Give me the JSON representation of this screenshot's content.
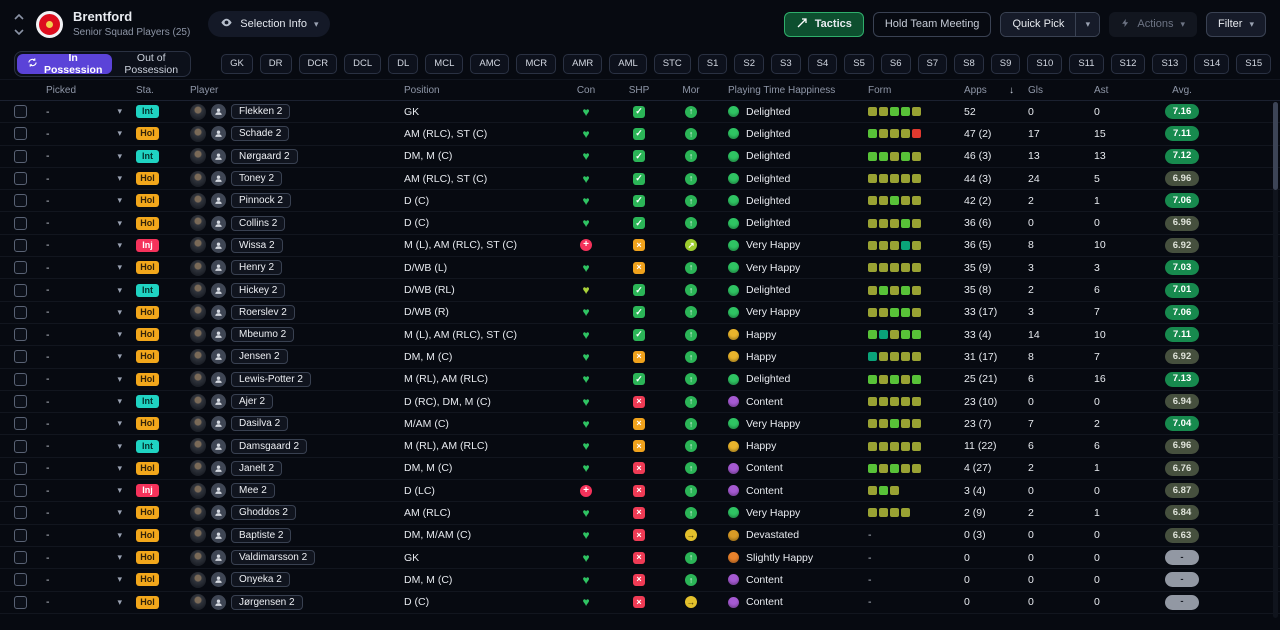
{
  "topbar": {
    "club_name": "Brentford",
    "subtitle": "Senior Squad Players (25)",
    "selection_info_label": "Selection Info",
    "tactics_label": "Tactics",
    "hold_team_meeting_label": "Hold Team Meeting",
    "quick_pick_label": "Quick Pick",
    "actions_label": "Actions",
    "filter_label": "Filter"
  },
  "tabs": {
    "in_possession": "In Possession",
    "out_of_possession": "Out of Possession"
  },
  "position_filters": [
    "GK",
    "DR",
    "DCR",
    "DCL",
    "DL",
    "MCL",
    "AMC",
    "MCR",
    "AMR",
    "AML",
    "STC",
    "S1",
    "S2",
    "S3",
    "S4",
    "S5",
    "S6",
    "S7",
    "S8",
    "S9",
    "S10",
    "S11",
    "S12",
    "S13",
    "S14",
    "S15"
  ],
  "icons": {
    "chevron_down": "▾",
    "sort_desc": "↓",
    "check": "✓",
    "cross": "×",
    "plus": "+",
    "heart": "♥",
    "arrow_up": "↑",
    "arrow_up_right": "↗",
    "arrow_right": "→"
  },
  "colors": {
    "accent_purple": "#5b43d8",
    "tactics_green": "#0d4f2f",
    "status_int": "#1fd3c2",
    "status_hol": "#f2a71b",
    "status_inj": "#f5325b"
  },
  "table": {
    "columns": {
      "picked": "Picked",
      "sta": "Sta.",
      "player": "Player",
      "position": "Position",
      "con": "Con",
      "shp": "SHP",
      "mor": "Mor",
      "happiness": "Playing Time Happiness",
      "form": "Form",
      "apps": "Apps",
      "gls": "Gls",
      "ast": "Ast",
      "avg": "Avg."
    },
    "rows": [
      {
        "picked": "-",
        "status": "Int",
        "status_type": "int",
        "name": "Flekken 2",
        "position": "GK",
        "con": "fit",
        "shp": "check",
        "mor": "up",
        "happiness": "Delighted",
        "happiness_type": "delighted",
        "form": [
          "olive",
          "olive",
          "green",
          "green",
          "olive"
        ],
        "apps": "52",
        "gls": "0",
        "ast": "0",
        "avg": "7.16",
        "avg_type": "good"
      },
      {
        "picked": "-",
        "status": "Hol",
        "status_type": "hol",
        "name": "Schade 2",
        "position": "AM (RLC), ST (C)",
        "con": "fit",
        "shp": "check",
        "mor": "up",
        "happiness": "Delighted",
        "happiness_type": "delighted",
        "form": [
          "green",
          "olive",
          "olive",
          "olive",
          "red"
        ],
        "apps": "47 (2)",
        "gls": "17",
        "ast": "15",
        "avg": "7.11",
        "avg_type": "good"
      },
      {
        "picked": "-",
        "status": "Int",
        "status_type": "int",
        "name": "Nørgaard 2",
        "position": "DM, M (C)",
        "con": "fit",
        "shp": "check",
        "mor": "up",
        "happiness": "Delighted",
        "happiness_type": "delighted",
        "form": [
          "green",
          "green",
          "olive",
          "green",
          "olive"
        ],
        "apps": "46 (3)",
        "gls": "13",
        "ast": "13",
        "avg": "7.12",
        "avg_type": "good"
      },
      {
        "picked": "-",
        "status": "Hol",
        "status_type": "hol",
        "name": "Toney 2",
        "position": "AM (RLC), ST (C)",
        "con": "fit",
        "shp": "check",
        "mor": "up",
        "happiness": "Delighted",
        "happiness_type": "delighted",
        "form": [
          "olive",
          "olive",
          "olive",
          "olive",
          "olive"
        ],
        "apps": "44 (3)",
        "gls": "24",
        "ast": "5",
        "avg": "6.96",
        "avg_type": "ok"
      },
      {
        "picked": "-",
        "status": "Hol",
        "status_type": "hol",
        "name": "Pinnock 2",
        "position": "D (C)",
        "con": "fit",
        "shp": "check",
        "mor": "up",
        "happiness": "Delighted",
        "happiness_type": "delighted",
        "form": [
          "olive",
          "olive",
          "green",
          "olive",
          "olive"
        ],
        "apps": "42 (2)",
        "gls": "2",
        "ast": "1",
        "avg": "7.06",
        "avg_type": "good"
      },
      {
        "picked": "-",
        "status": "Hol",
        "status_type": "hol",
        "name": "Collins 2",
        "position": "D (C)",
        "con": "fit",
        "shp": "check",
        "mor": "up",
        "happiness": "Delighted",
        "happiness_type": "delighted",
        "form": [
          "olive",
          "olive",
          "olive",
          "green",
          "olive"
        ],
        "apps": "36 (6)",
        "gls": "0",
        "ast": "0",
        "avg": "6.96",
        "avg_type": "ok"
      },
      {
        "picked": "-",
        "status": "Inj",
        "status_type": "inj",
        "name": "Wissa 2",
        "position": "M (L), AM (RLC), ST (C)",
        "con": "injured",
        "shp": "warn",
        "mor": "upright",
        "happiness": "Very Happy",
        "happiness_type": "very-happy",
        "form": [
          "olive",
          "olive",
          "olive",
          "teal",
          "olive"
        ],
        "apps": "36 (5)",
        "gls": "8",
        "ast": "10",
        "avg": "6.92",
        "avg_type": "ok"
      },
      {
        "picked": "-",
        "status": "Hol",
        "status_type": "hol",
        "name": "Henry 2",
        "position": "D/WB (L)",
        "con": "fit",
        "shp": "warn",
        "mor": "up",
        "happiness": "Very Happy",
        "happiness_type": "very-happy",
        "form": [
          "olive",
          "olive",
          "olive",
          "olive",
          "olive"
        ],
        "apps": "35 (9)",
        "gls": "3",
        "ast": "3",
        "avg": "7.03",
        "avg_type": "good"
      },
      {
        "picked": "-",
        "status": "Int",
        "status_type": "int",
        "name": "Hickey 2",
        "position": "D/WB (RL)",
        "con": "fit-light",
        "shp": "check",
        "mor": "up",
        "happiness": "Delighted",
        "happiness_type": "delighted",
        "form": [
          "olive",
          "green",
          "olive",
          "green",
          "olive"
        ],
        "apps": "35 (8)",
        "gls": "2",
        "ast": "6",
        "avg": "7.01",
        "avg_type": "good"
      },
      {
        "picked": "-",
        "status": "Hol",
        "status_type": "hol",
        "name": "Roerslev 2",
        "position": "D/WB (R)",
        "con": "fit",
        "shp": "check",
        "mor": "up",
        "happiness": "Very Happy",
        "happiness_type": "very-happy",
        "form": [
          "olive",
          "olive",
          "green",
          "green",
          "olive"
        ],
        "apps": "33 (17)",
        "gls": "3",
        "ast": "7",
        "avg": "7.06",
        "avg_type": "good"
      },
      {
        "picked": "-",
        "status": "Hol",
        "status_type": "hol",
        "name": "Mbeumo 2",
        "position": "M (L), AM (RLC), ST (C)",
        "con": "fit",
        "shp": "check",
        "mor": "up",
        "happiness": "Happy",
        "happiness_type": "happy",
        "form": [
          "green",
          "teal",
          "olive",
          "green",
          "green"
        ],
        "apps": "33 (4)",
        "gls": "14",
        "ast": "10",
        "avg": "7.11",
        "avg_type": "good"
      },
      {
        "picked": "-",
        "status": "Hol",
        "status_type": "hol",
        "name": "Jensen 2",
        "position": "DM, M (C)",
        "con": "fit",
        "shp": "warn",
        "mor": "up",
        "happiness": "Happy",
        "happiness_type": "happy",
        "form": [
          "teal",
          "olive",
          "olive",
          "olive",
          "olive"
        ],
        "apps": "31 (17)",
        "gls": "8",
        "ast": "7",
        "avg": "6.92",
        "avg_type": "ok"
      },
      {
        "picked": "-",
        "status": "Hol",
        "status_type": "hol",
        "name": "Lewis-Potter 2",
        "position": "M (RL), AM (RLC)",
        "con": "fit",
        "shp": "check",
        "mor": "up",
        "happiness": "Delighted",
        "happiness_type": "delighted",
        "form": [
          "green",
          "olive",
          "green",
          "olive",
          "green"
        ],
        "apps": "25 (21)",
        "gls": "6",
        "ast": "16",
        "avg": "7.13",
        "avg_type": "good"
      },
      {
        "picked": "-",
        "status": "Int",
        "status_type": "int",
        "name": "Ajer 2",
        "position": "D (RC), DM, M (C)",
        "con": "fit",
        "shp": "poor",
        "mor": "up",
        "happiness": "Content",
        "happiness_type": "content",
        "form": [
          "olive",
          "olive",
          "olive",
          "olive",
          "olive"
        ],
        "apps": "23 (10)",
        "gls": "0",
        "ast": "0",
        "avg": "6.94",
        "avg_type": "ok"
      },
      {
        "picked": "-",
        "status": "Hol",
        "status_type": "hol",
        "name": "Dasilva 2",
        "position": "M/AM (C)",
        "con": "fit",
        "shp": "warn",
        "mor": "up",
        "happiness": "Very Happy",
        "happiness_type": "very-happy",
        "form": [
          "olive",
          "olive",
          "green",
          "olive",
          "olive"
        ],
        "apps": "23 (7)",
        "gls": "7",
        "ast": "2",
        "avg": "7.04",
        "avg_type": "good"
      },
      {
        "picked": "-",
        "status": "Int",
        "status_type": "int",
        "name": "Damsgaard 2",
        "position": "M (RL), AM (RLC)",
        "con": "fit",
        "shp": "warn",
        "mor": "up",
        "happiness": "Happy",
        "happiness_type": "happy",
        "form": [
          "olive",
          "olive",
          "olive",
          "olive",
          "olive"
        ],
        "apps": "11 (22)",
        "gls": "6",
        "ast": "6",
        "avg": "6.96",
        "avg_type": "ok"
      },
      {
        "picked": "-",
        "status": "Hol",
        "status_type": "hol",
        "name": "Janelt 2",
        "position": "DM, M (C)",
        "con": "fit",
        "shp": "poor",
        "mor": "up",
        "happiness": "Content",
        "happiness_type": "content",
        "form": [
          "green",
          "olive",
          "green",
          "olive",
          "olive"
        ],
        "apps": "4 (27)",
        "gls": "2",
        "ast": "1",
        "avg": "6.76",
        "avg_type": "ok"
      },
      {
        "picked": "-",
        "status": "Inj",
        "status_type": "inj",
        "name": "Mee 2",
        "position": "D (LC)",
        "con": "injured",
        "shp": "poor",
        "mor": "up",
        "happiness": "Content",
        "happiness_type": "content",
        "form": [
          "olive",
          "green",
          "olive"
        ],
        "apps": "3 (4)",
        "gls": "0",
        "ast": "0",
        "avg": "6.87",
        "avg_type": "ok"
      },
      {
        "picked": "-",
        "status": "Hol",
        "status_type": "hol",
        "name": "Ghoddos 2",
        "position": "AM (RLC)",
        "con": "fit",
        "shp": "poor",
        "mor": "up",
        "happiness": "Very Happy",
        "happiness_type": "very-happy",
        "form": [
          "olive",
          "olive",
          "olive",
          "olive"
        ],
        "apps": "2 (9)",
        "gls": "2",
        "ast": "1",
        "avg": "6.84",
        "avg_type": "ok"
      },
      {
        "picked": "-",
        "status": "Hol",
        "status_type": "hol",
        "name": "Baptiste 2",
        "position": "DM, M/AM (C)",
        "con": "fit",
        "shp": "poor",
        "mor": "flat",
        "happiness": "Devastated",
        "happiness_type": "devastated",
        "form": "-",
        "apps": "0 (3)",
        "gls": "0",
        "ast": "0",
        "avg": "6.63",
        "avg_type": "ok"
      },
      {
        "picked": "-",
        "status": "Hol",
        "status_type": "hol",
        "name": "Valdimarsson 2",
        "position": "GK",
        "con": "fit",
        "shp": "poor",
        "mor": "up",
        "happiness": "Slightly Happy",
        "happiness_type": "slightly-happy",
        "form": "-",
        "apps": "0",
        "gls": "0",
        "ast": "0",
        "avg": "-",
        "avg_type": "none"
      },
      {
        "picked": "-",
        "status": "Hol",
        "status_type": "hol",
        "name": "Onyeka 2",
        "position": "DM, M (C)",
        "con": "fit",
        "shp": "poor",
        "mor": "up",
        "happiness": "Content",
        "happiness_type": "content",
        "form": "-",
        "apps": "0",
        "gls": "0",
        "ast": "0",
        "avg": "-",
        "avg_type": "none"
      },
      {
        "picked": "-",
        "status": "Hol",
        "status_type": "hol",
        "name": "Jørgensen 2",
        "position": "D (C)",
        "con": "fit",
        "shp": "poor",
        "mor": "flat",
        "happiness": "Content",
        "happiness_type": "content",
        "form": "-",
        "apps": "0",
        "gls": "0",
        "ast": "0",
        "avg": "-",
        "avg_type": "none"
      }
    ]
  }
}
